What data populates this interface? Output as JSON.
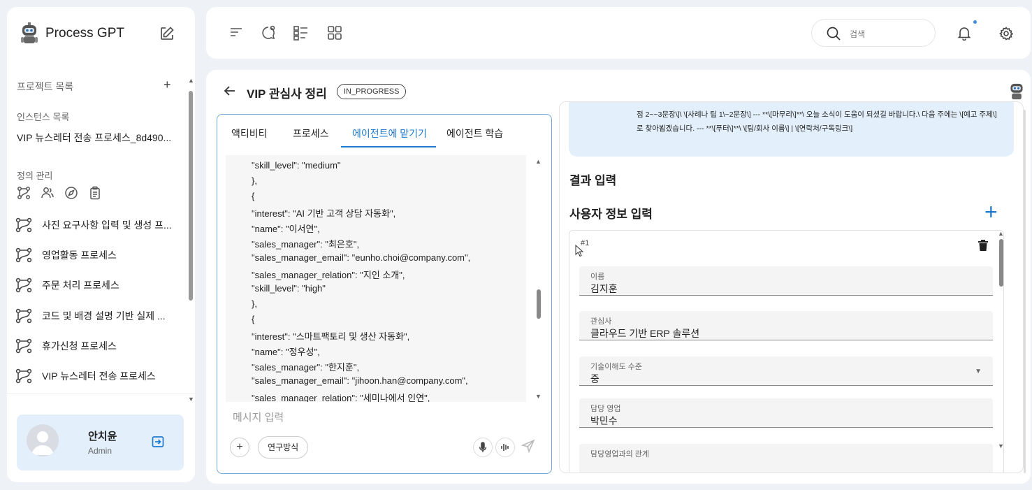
{
  "app": {
    "title": "Process GPT"
  },
  "sidebar": {
    "project_label": "프로젝트 목록",
    "project_add": "+",
    "instance_label": "인스턴스 목록",
    "instance_item": "VIP 뉴스레터 전송 프로세스_8d490...",
    "definition_label": "정의 관리",
    "definition_tools": [
      "flow-icon",
      "people-icon",
      "compass-icon",
      "clipboard-icon"
    ],
    "definitions": [
      "사진 요구사항 입력 및 생성 프...",
      "영업활동 프로세스",
      "주문 처리 프로세스",
      "코드 및 배경 설명 기반 실제 ...",
      "휴가신청 프로세스",
      "VIP 뉴스레터 전송 프로세스"
    ]
  },
  "user": {
    "name": "안치윤",
    "role": "Admin"
  },
  "header": {
    "search_placeholder": "검색"
  },
  "page": {
    "title": "VIP 관심사 정리",
    "status": "IN_PROGRESS"
  },
  "chat": {
    "tabs": [
      "액티비티",
      "프로세스",
      "에이전트에 맡기기",
      "에이전트 학습"
    ],
    "active_tab": 2,
    "code_lines": [
      "\"skill_level\": \"medium\"",
      "},",
      "{",
      "\"interest\": \"AI 기반 고객 상담 자동화\",",
      "\"name\": \"이서연\",",
      "\"sales_manager\": \"최은호\",",
      "\"sales_manager_email\": \"eunho.choi@company.com\",",
      "\"sales_manager_relation\": \"지인 소개\",",
      "\"skill_level\": \"high\"",
      "},",
      "{",
      "\"interest\": \"스마트팩토리 및 생산 자동화\",",
      "\"name\": \"정우성\",",
      "\"sales_manager\": \"한지훈\",",
      "\"sales_manager_email\": \"jihoon.han@company.com\",",
      "\"sales_manager_relation\": \"세미나에서 인연\","
    ],
    "input_placeholder": "메시지 입력",
    "attach_label": "+",
    "research_label": "연구방식"
  },
  "result": {
    "preview_text": "점 2~~3문장\\]\\ \\[사례나 팁 1\\~2문장\\] --- **\\[마무리\\]**\\ 오늘 소식이 도움이 되셨길 바랍니다.\\ 다음 주에는 \\[예고 주제\\]로 찾아뵙겠습니다. --- **\\[푸터\\]**\\ \\[팀/회사 이름\\] | \\[연락처/구독링크\\]",
    "section_title": "결과 입력",
    "userinfo_title": "사용자 정보 입력",
    "add_label": "+",
    "form_no": "#1",
    "fields": [
      {
        "label": "이름",
        "value": "김지훈"
      },
      {
        "label": "관심사",
        "value": "클라우드 기반 ERP 솔루션"
      },
      {
        "label": "기술이해도 수준",
        "value": "중"
      },
      {
        "label": "담당 영업",
        "value": "박민수"
      },
      {
        "label": "담당영업과의 관계",
        "value": ""
      }
    ]
  },
  "colors": {
    "accent": "#1f7ad0",
    "highlight_bg": "#e3f0fb",
    "page_bg": "#eef1f6"
  }
}
